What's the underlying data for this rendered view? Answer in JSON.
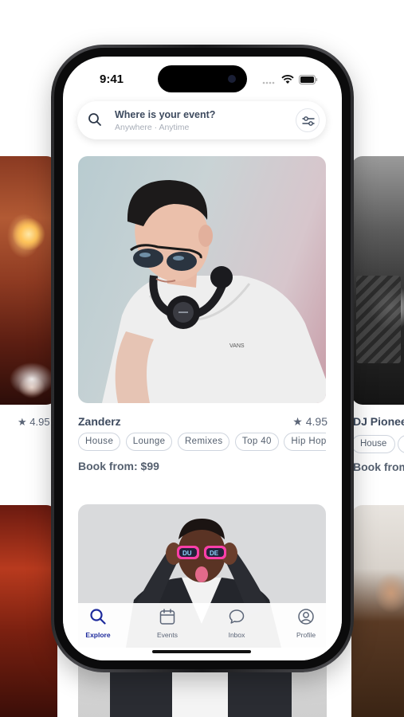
{
  "status_bar": {
    "time": "9:41"
  },
  "search": {
    "title": "Where is your event?",
    "subtitle": "Anywhere · Anytime"
  },
  "featured_card": {
    "name": "Zanderz",
    "rating": "4.95",
    "tags": [
      "House",
      "Lounge",
      "Remixes",
      "Top 40",
      "Hip Hop"
    ],
    "price_label": "Book from: $99"
  },
  "left_card": {
    "rating": "4.95"
  },
  "right_card": {
    "name": "DJ Pionee",
    "tags": [
      "House",
      "L"
    ],
    "price_label": "Book from"
  },
  "glasses_text": "DU DE",
  "tabbar": {
    "items": [
      {
        "label": "Explore",
        "icon": "search-icon",
        "active": true
      },
      {
        "label": "Events",
        "icon": "calendar-icon",
        "active": false
      },
      {
        "label": "Inbox",
        "icon": "chat-bubble-icon",
        "active": false
      },
      {
        "label": "Profile",
        "icon": "user-circle-icon",
        "active": false
      }
    ]
  },
  "colors": {
    "accent": "#1d2a9c",
    "text": "#3d4a5e",
    "muted": "#a8aeb8",
    "border": "#cfd5de"
  }
}
